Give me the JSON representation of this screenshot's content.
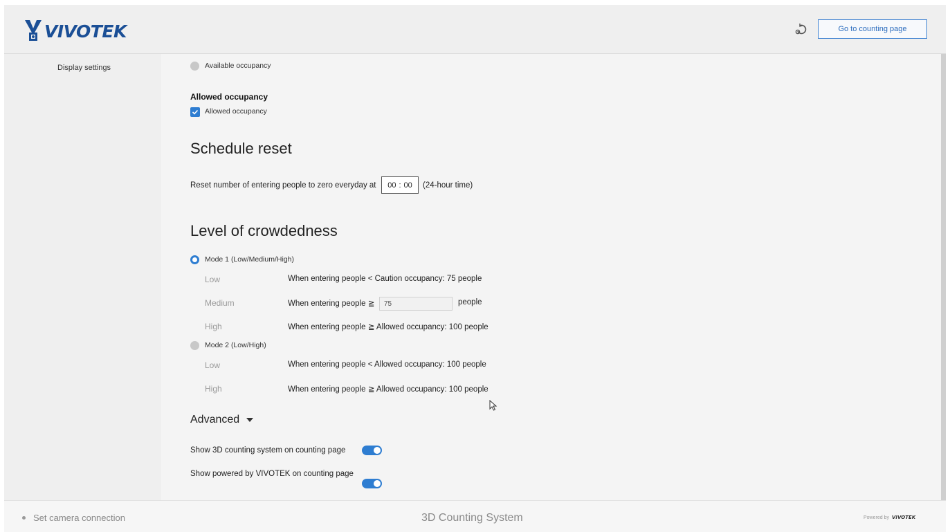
{
  "header": {
    "logo_text": "VIVOTEK",
    "refresh_icon": "refresh-icon",
    "goto_label": "Go to counting page"
  },
  "sidebar": {
    "items": [
      {
        "label": "Display settings"
      }
    ]
  },
  "main": {
    "available_occupancy": {
      "label": "Available occupancy",
      "checked": false
    },
    "allowed_occupancy": {
      "heading": "Allowed occupancy",
      "checkbox_label": "Allowed occupancy",
      "checked": true
    },
    "schedule_reset": {
      "title": "Schedule reset",
      "label": "Reset number of entering people to zero everyday at",
      "hour": "00",
      "separator": ":",
      "minute": "00",
      "suffix": "(24-hour time)"
    },
    "crowdedness": {
      "title": "Level of crowdedness",
      "mode1": {
        "label": "Mode 1 (Low/Medium/High)",
        "selected": true,
        "rows": [
          {
            "level": "Low",
            "desc": "When entering people < Caution occupancy: 75 people"
          },
          {
            "level": "Medium",
            "desc": "When entering people ≧",
            "input_value": "75",
            "unit": "people"
          },
          {
            "level": "High",
            "desc": "When entering people ≧ Allowed occupancy: 100 people"
          }
        ]
      },
      "mode2": {
        "label": "Mode 2 (Low/High)",
        "selected": false,
        "rows": [
          {
            "level": "Low",
            "desc": "When entering people < Allowed occupancy: 100 people"
          },
          {
            "level": "High",
            "desc": "When entering people ≧ Allowed occupancy: 100 people"
          }
        ]
      }
    },
    "advanced": {
      "title": "Advanced",
      "toggles": [
        {
          "label": "Show 3D counting system on counting page",
          "on": true
        },
        {
          "label": "Show powered by VIVOTEK on counting page",
          "on": true
        }
      ]
    }
  },
  "footer": {
    "left": "Set camera connection",
    "center": "3D Counting System",
    "powered_by": "Powered by",
    "brand": "VIVOTEK"
  },
  "colors": {
    "accent": "#2e7dd1",
    "brand": "#1b4f96"
  }
}
